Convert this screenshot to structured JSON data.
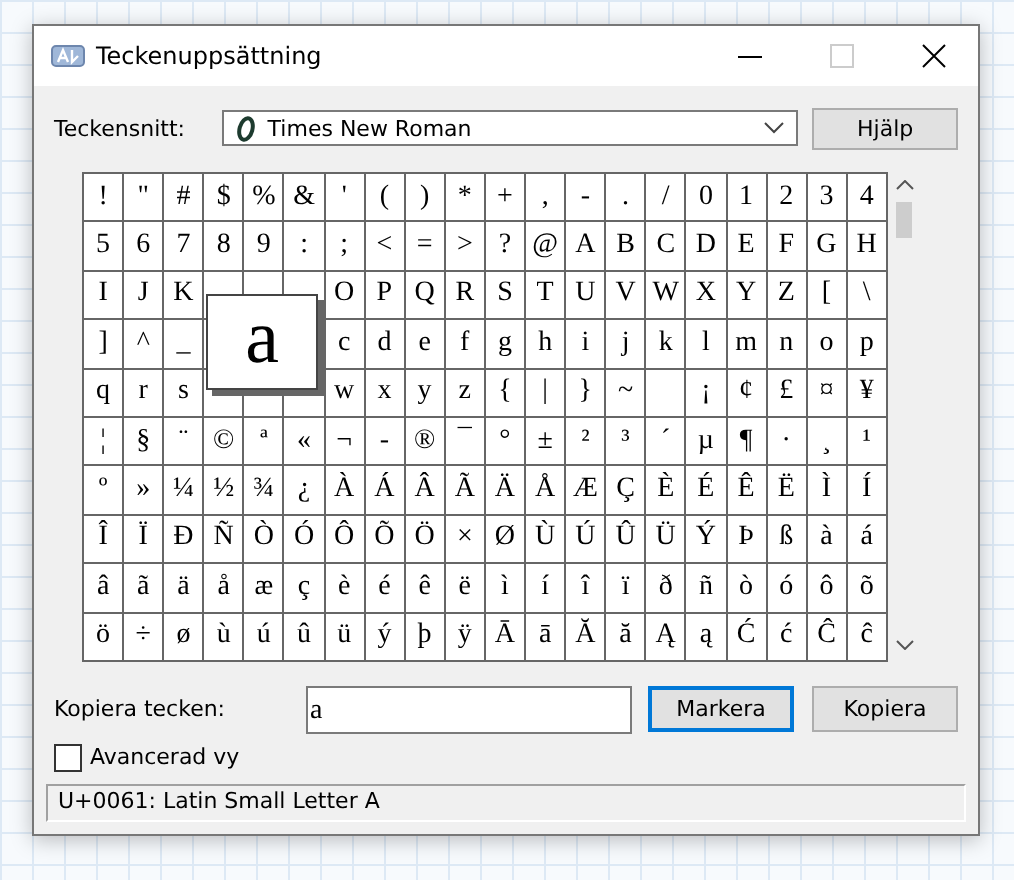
{
  "window": {
    "title": "Teckenuppsättning"
  },
  "font": {
    "label": "Teckensnitt:",
    "value": "Times New Roman",
    "help_button": "Hjälp"
  },
  "grid": {
    "rows": [
      [
        "!",
        "\"",
        "#",
        "$",
        "%",
        "&",
        "'",
        "(",
        ")",
        "*",
        "+",
        ",",
        "-",
        ".",
        "/",
        "0",
        "1",
        "2",
        "3",
        "4"
      ],
      [
        "5",
        "6",
        "7",
        "8",
        "9",
        ":",
        ";",
        "<",
        "=",
        ">",
        "?",
        "@",
        "A",
        "B",
        "C",
        "D",
        "E",
        "F",
        "G",
        "H"
      ],
      [
        "I",
        "J",
        "K",
        null,
        null,
        null,
        "O",
        "P",
        "Q",
        "R",
        "S",
        "T",
        "U",
        "V",
        "W",
        "X",
        "Y",
        "Z",
        "[",
        "\\"
      ],
      [
        "]",
        "^",
        "_",
        null,
        null,
        null,
        "c",
        "d",
        "e",
        "f",
        "g",
        "h",
        "i",
        "j",
        "k",
        "l",
        "m",
        "n",
        "o",
        "p"
      ],
      [
        "q",
        "r",
        "s",
        null,
        null,
        null,
        "w",
        "x",
        "y",
        "z",
        "{",
        "|",
        "}",
        "~",
        null,
        "¡",
        "¢",
        "£",
        "¤",
        "¥"
      ],
      [
        "¦",
        "§",
        "¨",
        "©",
        "ª",
        "«",
        "¬",
        "-",
        "®",
        "¯",
        "°",
        "±",
        "²",
        "³",
        "´",
        "µ",
        "¶",
        "·",
        "¸",
        "¹"
      ],
      [
        "º",
        "»",
        "¼",
        "½",
        "¾",
        "¿",
        "À",
        "Á",
        "Â",
        "Ã",
        "Ä",
        "Å",
        "Æ",
        "Ç",
        "È",
        "É",
        "Ê",
        "Ë",
        "Ì",
        "Í"
      ],
      [
        "Î",
        "Ï",
        "Ð",
        "Ñ",
        "Ò",
        "Ó",
        "Ô",
        "Õ",
        "Ö",
        "×",
        "Ø",
        "Ù",
        "Ú",
        "Û",
        "Ü",
        "Ý",
        "Þ",
        "ß",
        "à",
        "á"
      ],
      [
        "â",
        "ã",
        "ä",
        "å",
        "æ",
        "ç",
        "è",
        "é",
        "ê",
        "ë",
        "ì",
        "í",
        "î",
        "ï",
        "ð",
        "ñ",
        "ò",
        "ó",
        "ô",
        "õ"
      ],
      [
        "ö",
        "÷",
        "ø",
        "ù",
        "ú",
        "û",
        "ü",
        "ý",
        "þ",
        "ÿ",
        "Ā",
        "ā",
        "Ă",
        "ă",
        "Ą",
        "ą",
        "Ć",
        "ć",
        "Ĉ",
        "ĉ"
      ]
    ],
    "magnified": "a"
  },
  "copy": {
    "label": "Kopiera tecken:",
    "value": "a",
    "select_button": "Markera",
    "copy_button": "Kopiera"
  },
  "advanced": {
    "label": "Avancerad vy",
    "checked": false
  },
  "status_bar": "U+0061: Latin Small Letter A"
}
